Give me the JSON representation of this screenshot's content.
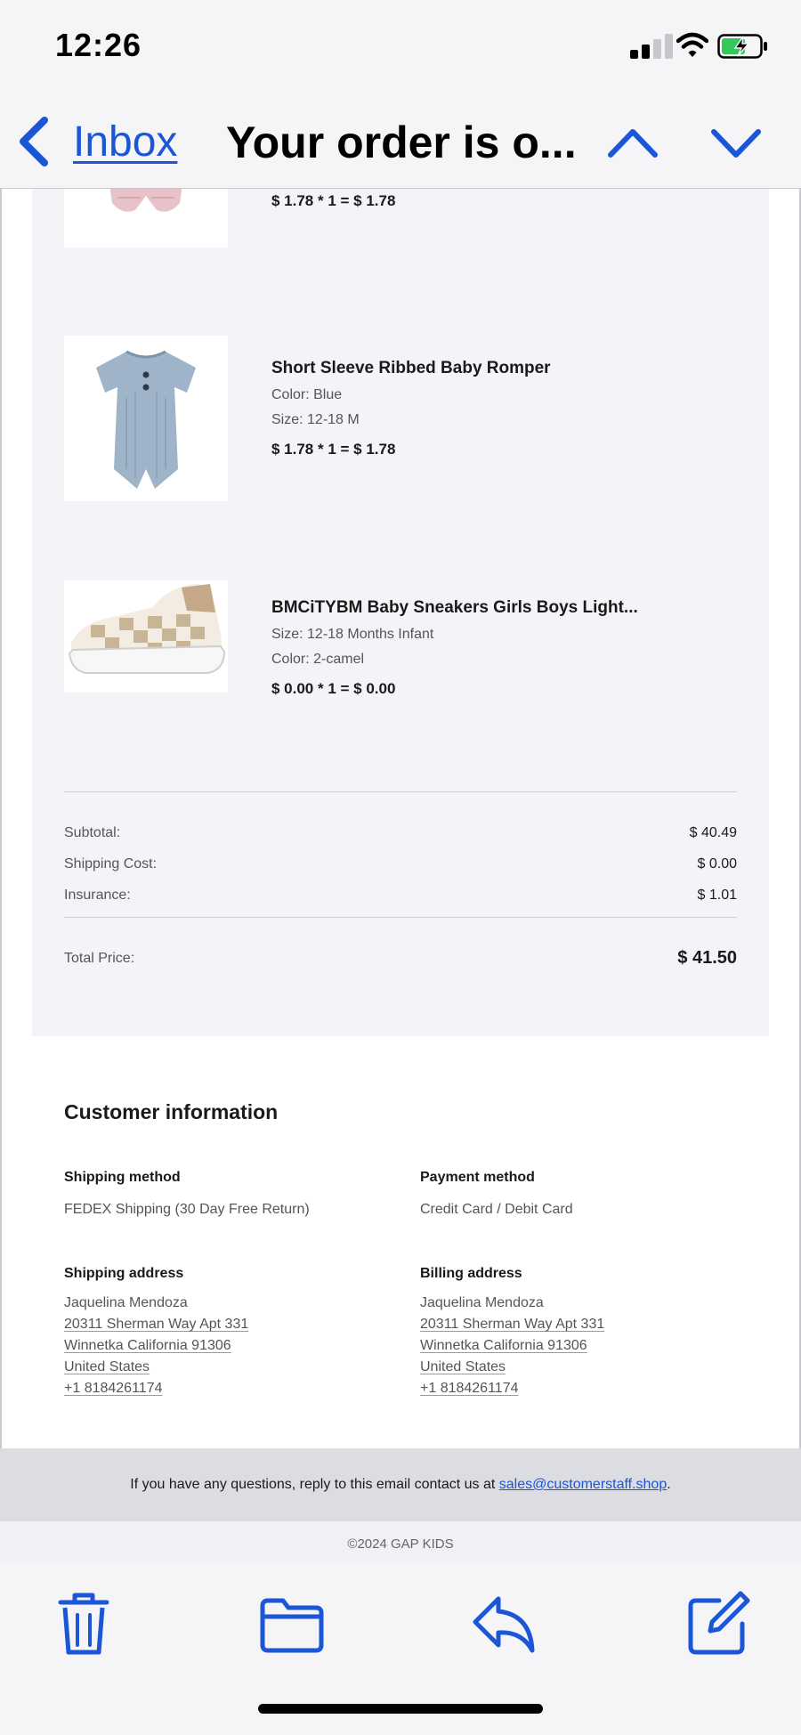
{
  "status_bar": {
    "time": "12:26"
  },
  "nav": {
    "back_label": "Inbox",
    "title": "Your order is o..."
  },
  "products": [
    {
      "name": "",
      "attrs": [],
      "price": "$ 1.78 * 1 = $ 1.78",
      "image": "pink-romper-image"
    },
    {
      "name": "Short Sleeve Ribbed Baby Romper",
      "attrs": [
        "Color: Blue",
        "Size: 12-18 M"
      ],
      "price": "$ 1.78 * 1 = $ 1.78",
      "image": "blue-romper-image"
    },
    {
      "name": "BMCiTYBM Baby Sneakers Girls Boys Light...",
      "attrs": [
        "Size: 12-18 Months Infant",
        "Color: 2-camel"
      ],
      "price": "$ 0.00 * 1 = $ 0.00",
      "image": "checkered-sneaker-image"
    }
  ],
  "summary": {
    "subtotal_label": "Subtotal:",
    "subtotal": "$ 40.49",
    "shipping_label": "Shipping Cost:",
    "shipping": "$ 0.00",
    "insurance_label": "Insurance:",
    "insurance": "$ 1.01",
    "total_label": "Total Price:",
    "total": "$ 41.50"
  },
  "customer": {
    "title": "Customer information",
    "shipping_method_label": "Shipping method",
    "shipping_method": "FEDEX Shipping (30 Day Free Return)",
    "payment_method_label": "Payment method",
    "payment_method": "Credit Card / Debit Card",
    "shipping_address_label": "Shipping address",
    "billing_address_label": "Billing address",
    "shipping_address": [
      "Jaquelina Mendoza",
      "20311 Sherman Way Apt 331",
      "Winnetka California 91306",
      "United States",
      "+1 8184261174"
    ],
    "billing_address": [
      "Jaquelina Mendoza",
      "20311 Sherman Way Apt 331",
      "Winnetka California 91306",
      "United States",
      "+1 8184261174"
    ]
  },
  "footer": {
    "contact_prefix": "If you have any questions, reply to this email contact us at ",
    "contact_email": "sales@customerstaff.shop",
    "contact_suffix": ".",
    "copyright": "©2024 GAP KIDS"
  },
  "toolbar": {
    "icons": [
      "trash-icon",
      "folder-icon",
      "reply-icon",
      "compose-icon"
    ]
  },
  "colors": {
    "accent": "#1a56d6",
    "card_bg": "#f4f4f8",
    "footer_bg": "#dcdde2"
  }
}
